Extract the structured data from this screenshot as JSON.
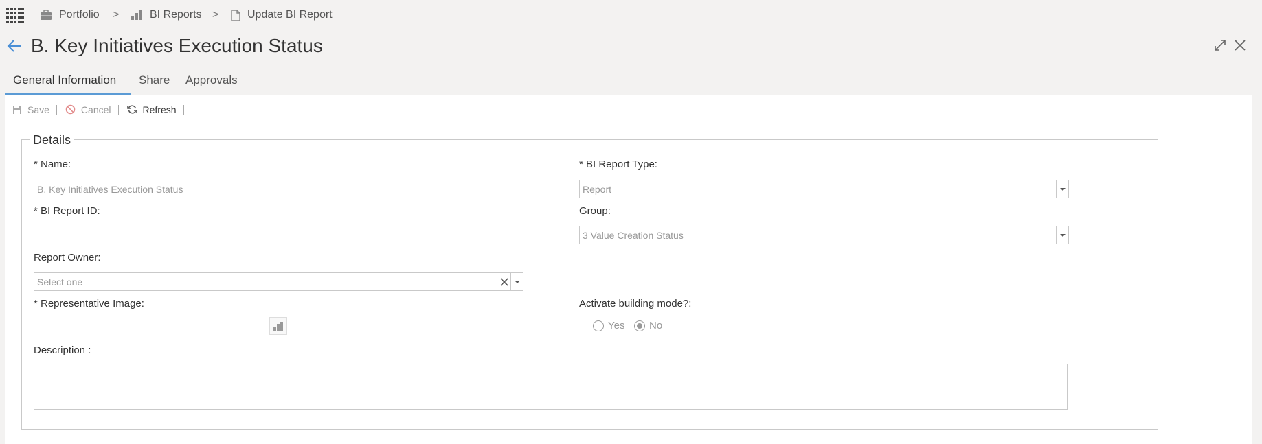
{
  "breadcrumb": {
    "items": [
      "Portfolio",
      "BI Reports",
      "Update BI Report"
    ],
    "separator": ">"
  },
  "page": {
    "title": "B. Key Initiatives Execution Status"
  },
  "tabs": [
    {
      "label": "General Information",
      "active": true
    },
    {
      "label": "Share",
      "active": false
    },
    {
      "label": "Approvals",
      "active": false
    }
  ],
  "toolbar": {
    "save_label": "Save",
    "cancel_label": "Cancel",
    "refresh_label": "Refresh"
  },
  "form": {
    "legend": "Details",
    "name": {
      "label": "* Name:",
      "value": "B. Key Initiatives Execution Status"
    },
    "bi_report_type": {
      "label": "* BI Report Type:",
      "value": "Report"
    },
    "bi_report_id": {
      "label": "* BI Report ID:",
      "value": ""
    },
    "group": {
      "label": "Group:",
      "value": "3 Value Creation Status"
    },
    "report_owner": {
      "label": "Report Owner:",
      "placeholder": "Select one"
    },
    "representative_image": {
      "label": "* Representative Image:"
    },
    "building_mode": {
      "label": "Activate building mode?:",
      "options": [
        "Yes",
        "No"
      ],
      "selected": "No"
    },
    "description": {
      "label": "Description :",
      "value": ""
    }
  },
  "colors": {
    "accent": "#5b9bd5",
    "background": "#f3f2f1",
    "border": "#c9c9c9"
  },
  "icons": [
    "apps-grid-icon",
    "briefcase-icon",
    "bar-chart-icon",
    "document-icon",
    "back-arrow-icon",
    "expand-icon",
    "close-icon",
    "save-icon",
    "cancel-icon",
    "refresh-icon",
    "dropdown-arrow-icon",
    "clear-icon",
    "chart-thumbnail-icon"
  ]
}
